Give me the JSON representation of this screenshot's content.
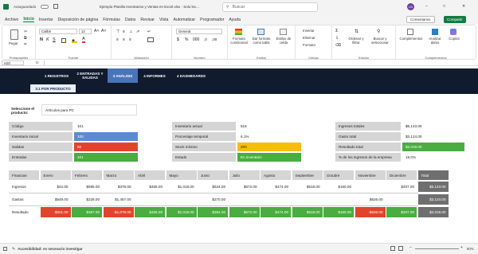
{
  "titlebar": {
    "autosave": "Autoguardado",
    "doc_title": "Ejemplo Planilla Inventarios y Ventas en Excel.xlsx · Solo lec...",
    "search_placeholder": "Buscar",
    "user_initials": "LB"
  },
  "menu": [
    "Archivo",
    "Inicio",
    "Insertar",
    "Disposición de página",
    "Fórmulas",
    "Datos",
    "Revisar",
    "Vista",
    "Automatizar",
    "Programador",
    "Ayuda"
  ],
  "menu_active": "Inicio",
  "menu_right": {
    "comments": "Comentarios",
    "share": "Compartir"
  },
  "ribbon": {
    "clipboard": {
      "paste": "Pegar",
      "label": "Portapapeles"
    },
    "font": {
      "name": "Calibri",
      "size": "12",
      "label": "Fuente"
    },
    "align": {
      "label": "Alineación"
    },
    "number": {
      "format": "General",
      "label": "Número"
    },
    "styles": {
      "cond": "Formato condicional",
      "table": "Dar formato como tabla",
      "cell": "Estilos de celda",
      "label": "Estilos"
    },
    "cells": {
      "insert": "Insertar",
      "delete": "Eliminar",
      "format": "Formato",
      "label": "Celdas"
    },
    "editing": {
      "sort": "Ordenar y filtrar",
      "find": "Buscar y seleccionar",
      "label": "Edición"
    },
    "addins": {
      "complements": "Complementos",
      "analyze": "Analizar datos",
      "copilot": "Copilot",
      "label": "Complementos"
    }
  },
  "formula_bar": {
    "cell_ref": "H20",
    "fx": "fx"
  },
  "nav_tabs": [
    "1 REGISTROS",
    "2 ENTRADAS Y SALIDAS",
    "3 ANÁLISIS",
    "4 INFORMES",
    "4 DASHBOARDS"
  ],
  "nav_active": "3 ANÁLISIS",
  "sub_tab": "3.1 POR PRODUCTO",
  "product": {
    "label": "Seleccione el producto:",
    "value": "Artículos para PC"
  },
  "left_block": [
    {
      "label": "Código",
      "value": "101"
    },
    {
      "label": "Inventario inicial",
      "value": "100"
    },
    {
      "label": "Salidas",
      "value": "60"
    },
    {
      "label": "Entradas",
      "value": "101"
    }
  ],
  "mid_block": [
    {
      "label": "Inventario actual",
      "value": "515"
    },
    {
      "label": "Porcentaje temporal",
      "value": "6.1%"
    },
    {
      "label": "Stock mínimo",
      "value": "200"
    },
    {
      "label": "Estado",
      "value": "En inventario"
    }
  ],
  "right_block": [
    {
      "label": "Ingresos totales",
      "value": "$5,143.00"
    },
    {
      "label": "Gasto total",
      "value": "$3,124.00"
    },
    {
      "label": "Resultado total",
      "value": "$2,019.00"
    },
    {
      "label": "% de los ingresos de la empresa",
      "value": "18.0%"
    }
  ],
  "finance": {
    "header": [
      "Finanzas",
      "Enero",
      "Febrero",
      "Marzo",
      "Abril",
      "Mayo",
      "Junio",
      "Julio",
      "Agosto",
      "Septiembre",
      "Octubre",
      "Noviembre",
      "Diciembre",
      "Total"
    ],
    "rows": [
      {
        "label": "Ingresos",
        "cells": [
          "$42.00",
          "$595.00",
          "$378.00",
          "$455.00",
          "$1,018.00",
          "$624.00",
          "$672.00",
          "$474.00",
          "$518.00",
          "$160.00",
          "",
          "$207.00",
          "$5,143.00"
        ]
      },
      {
        "label": "Gastos",
        "cells": [
          "$549.00",
          "$228.00",
          "$1,457.00",
          "",
          "",
          "$270.00",
          "",
          "",
          "",
          "",
          "$626.00",
          "",
          "$3,124.00"
        ]
      },
      {
        "label": "Resultado",
        "cells": [
          "-$501.00",
          "$367.00",
          "-$1,079.00",
          "$455.00",
          "$1,018.00",
          "$354.00",
          "$672.00",
          "$474.00",
          "$518.00",
          "$160.00",
          "-$626.00",
          "$207.00",
          "$2,019.00"
        ]
      }
    ]
  },
  "status": {
    "accessibility": "Accesibilidad: es necesario investigar",
    "zoom": "80%"
  },
  "colors": {
    "nav_bg": "#101b2d",
    "active_tab": "#4a74b8",
    "positive": "#49ad3f",
    "negative": "#e2442b",
    "warning": "#f7bd0b",
    "info": "#5b8ccf"
  }
}
